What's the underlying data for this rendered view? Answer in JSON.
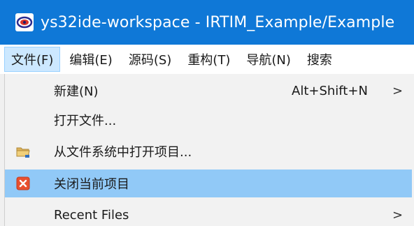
{
  "window": {
    "title": "ys32ide-workspace - IRTIM_Example/Example"
  },
  "colors": {
    "titlebar": "#0f78d7",
    "highlight": "#91c9f7",
    "menu_active": "#cce8ff"
  },
  "menubar": {
    "items": [
      {
        "label": "文件(F)"
      },
      {
        "label": "编辑(E)"
      },
      {
        "label": "源码(S)"
      },
      {
        "label": "重构(T)"
      },
      {
        "label": "导航(N)"
      },
      {
        "label": "搜索"
      }
    ]
  },
  "file_menu": {
    "items": [
      {
        "label": "新建(N)",
        "shortcut": "Alt+Shift+N",
        "arrow": ">"
      },
      {
        "label": "打开文件..."
      },
      {
        "label": "从文件系统中打开项目...",
        "icon": "folder-icon"
      },
      {
        "label": "关闭当前项目",
        "icon": "close-project-icon"
      },
      {
        "label": "Recent Files",
        "arrow": ">"
      }
    ]
  }
}
